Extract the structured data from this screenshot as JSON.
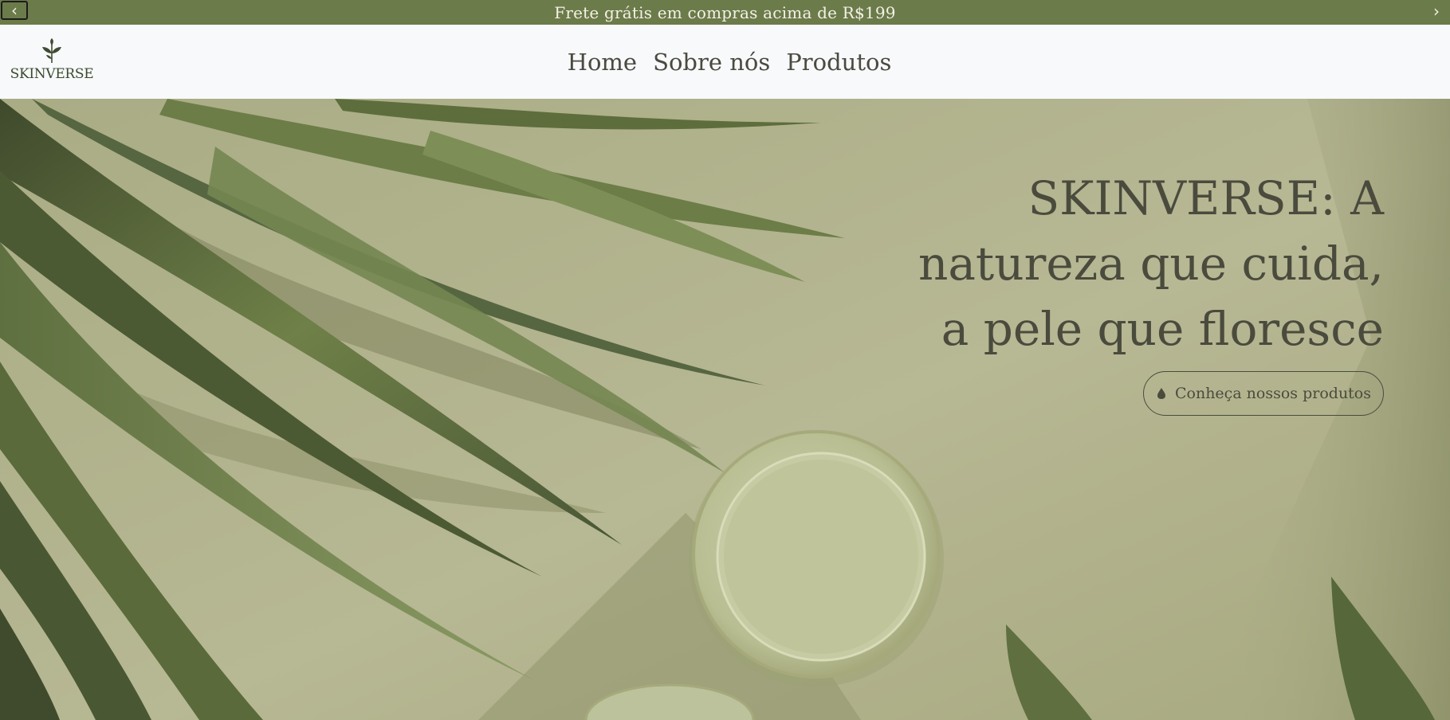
{
  "announcement": {
    "text": "Frete grátis em compras acima de R$199",
    "prev_icon": "chevron-left-icon",
    "next_icon": "chevron-right-icon",
    "prev_glyph": "‹",
    "next_glyph": "›"
  },
  "header": {
    "logo_text": "SKINVERSE",
    "logo_icon": "leaf-sprout-icon",
    "nav": [
      {
        "label": "Home"
      },
      {
        "label": "Sobre nós"
      },
      {
        "label": "Produtos"
      }
    ]
  },
  "hero": {
    "title_lines": [
      "SKINVERSE: A",
      "natureza que cuida,",
      "a pele que floresce"
    ],
    "cta_label": "Conheça nossos produtos",
    "cta_icon": "water-drop-icon"
  },
  "colors": {
    "accent": "#6b7b4a",
    "announce_text": "#f4f1e6",
    "header_bg": "#f8f9fb",
    "hero_bg": "#b3b48f",
    "text_dark": "#4a4b3d"
  }
}
